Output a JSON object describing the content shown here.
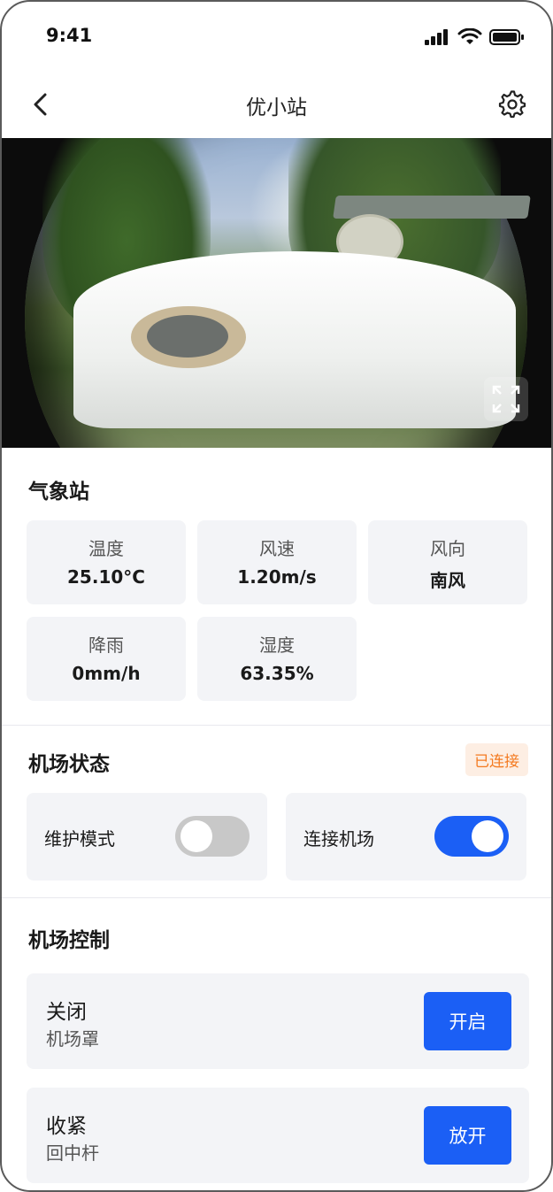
{
  "status_bar": {
    "time": "9:41"
  },
  "nav": {
    "title": "优小站"
  },
  "weather": {
    "title": "气象站",
    "items": [
      {
        "label": "温度",
        "value": "25.10°C"
      },
      {
        "label": "风速",
        "value": "1.20m/s"
      },
      {
        "label": "风向",
        "value": "南风"
      },
      {
        "label": "降雨",
        "value": "0mm/h"
      },
      {
        "label": "湿度",
        "value": "63.35%"
      }
    ]
  },
  "airport_status": {
    "title": "机场状态",
    "badge": "已连接",
    "toggles": [
      {
        "label": "维护模式",
        "on": false
      },
      {
        "label": "连接机场",
        "on": true
      }
    ]
  },
  "airport_control": {
    "title": "机场控制",
    "items": [
      {
        "state": "关闭",
        "name": "机场罩",
        "action": "开启"
      },
      {
        "state": "收紧",
        "name": "回中杆",
        "action": "放开"
      }
    ]
  },
  "colors": {
    "accent": "#1b5ff5",
    "badge_text": "#f47a20",
    "badge_bg": "#fdeee3",
    "card_bg": "#f3f4f7"
  }
}
